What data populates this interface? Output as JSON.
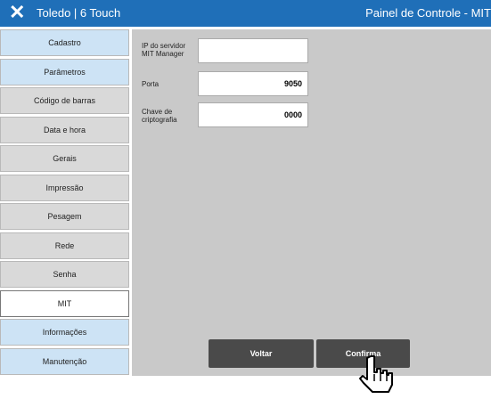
{
  "titlebar": {
    "left_title": "Toledo | 6 Touch",
    "right_title": "Painel de Controle - MIT",
    "close_icon": "close-icon"
  },
  "sidebar": {
    "items": [
      {
        "label": "Cadastro",
        "style": "blue"
      },
      {
        "label": "Parâmetros",
        "style": "blue"
      },
      {
        "label": "Código de barras",
        "style": "gray"
      },
      {
        "label": "Data e hora",
        "style": "gray"
      },
      {
        "label": "Gerais",
        "style": "gray"
      },
      {
        "label": "Impressão",
        "style": "gray"
      },
      {
        "label": "Pesagem",
        "style": "gray"
      },
      {
        "label": "Rede",
        "style": "gray"
      },
      {
        "label": "Senha",
        "style": "gray"
      },
      {
        "label": "MIT",
        "style": "active"
      },
      {
        "label": "Informações",
        "style": "blue"
      },
      {
        "label": "Manutenção",
        "style": "blue"
      }
    ]
  },
  "form": {
    "server_ip_label": "IP do servidor MIT Manager",
    "server_ip_value": "",
    "port_label": "Porta",
    "port_value": "9050",
    "crypto_key_label": "Chave de criptografia",
    "crypto_key_value": "0000"
  },
  "buttons": {
    "back_label": "Voltar",
    "confirm_label": "Confirma"
  },
  "colors": {
    "titlebar": "#1f6fb8",
    "sidebar_blue": "#cde3f5",
    "sidebar_gray": "#d9d9d9",
    "panel": "#c9c9c9",
    "button": "#4a4a4a"
  }
}
